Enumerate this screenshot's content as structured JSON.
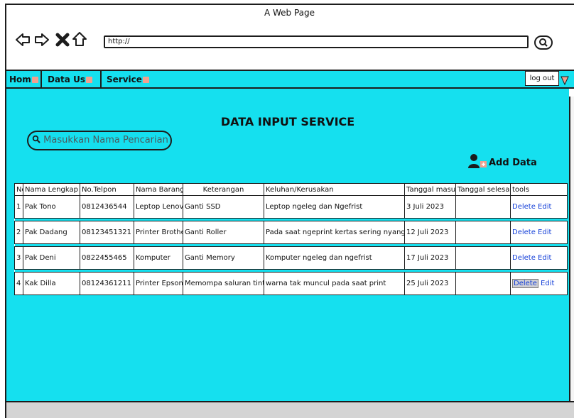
{
  "window": {
    "title": "A Web Page"
  },
  "browser": {
    "url": "http://"
  },
  "menu": {
    "items": [
      {
        "label": "Hom"
      },
      {
        "label": "Data Us"
      },
      {
        "label": "Service"
      }
    ],
    "logout_label": "log out"
  },
  "page": {
    "title": "DATA INPUT SERVICE",
    "search_placeholder": "Masukkan Nama Pencarian",
    "add_data_label": "Add Data"
  },
  "table": {
    "headers": [
      "No",
      "Nama Lengkap",
      "No.Telpon",
      "Nama Barang",
      "Keterangan",
      "Keluhan/Kerusakan",
      "Tanggal masuk",
      "Tanggal selesai",
      "tools"
    ],
    "rows": [
      {
        "no": "1",
        "nama": "Pak Tono",
        "telpon": "0812436544",
        "barang": "Leptop Lenovo",
        "keterangan": "Ganti SSD",
        "keluhan": "Leptop ngeleg dan Ngefrist",
        "masuk": "3 Juli 2023",
        "selesai": ""
      },
      {
        "no": "2",
        "nama": "Pak Dadang",
        "telpon": "08123451321",
        "barang": "Printer Brother",
        "keterangan": "Ganti Roller",
        "keluhan": "Pada saat ngeprint kertas sering nyangkut",
        "masuk": "12 Juli 2023",
        "selesai": ""
      },
      {
        "no": "3",
        "nama": "Pak Deni",
        "telpon": "0822455465",
        "barang": "Komputer",
        "keterangan": "Ganti Memory",
        "keluhan": "Komputer ngeleg dan ngefrist",
        "masuk": "17 Juli 2023",
        "selesai": ""
      },
      {
        "no": "4",
        "nama": "Kak Dilla",
        "telpon": "08124361211",
        "barang": "Printer Epson",
        "keterangan": "Memompa saluran tinta",
        "keluhan": "warna tak muncul pada saat print",
        "masuk": "25 Juli 2023",
        "selesai": ""
      }
    ],
    "delete_label": "Delete",
    "edit_label": "Edit"
  },
  "colors": {
    "content_bg": "#15e0ef",
    "link": "#1540d8",
    "footer": "#d4d4d4"
  }
}
